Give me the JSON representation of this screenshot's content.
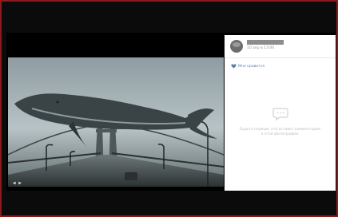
{
  "post": {
    "author_name": "",
    "date": "10 апр в 13:00"
  },
  "actions": {
    "like_label": "Мне нравится"
  },
  "comments": {
    "empty_text": "Будьте первым, кто оставит комментарий к этой фотографии."
  },
  "photo": {
    "counter": "◀ ▶"
  },
  "colors": {
    "frame_border": "#8b1a1a",
    "link": "#5a7fad",
    "sidebar_bg": "#ffffff"
  },
  "icons": {
    "like": "heart-icon",
    "comment": "speech-bubble-icon"
  }
}
